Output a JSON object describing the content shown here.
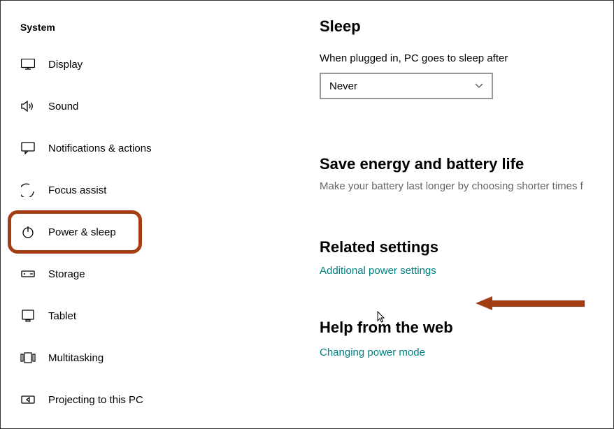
{
  "sidebar": {
    "title": "System",
    "items": [
      {
        "label": "Display"
      },
      {
        "label": "Sound"
      },
      {
        "label": "Notifications & actions"
      },
      {
        "label": "Focus assist"
      },
      {
        "label": "Power & sleep"
      },
      {
        "label": "Storage"
      },
      {
        "label": "Tablet"
      },
      {
        "label": "Multitasking"
      },
      {
        "label": "Projecting to this PC"
      }
    ]
  },
  "main": {
    "sleep_heading": "Sleep",
    "sleep_label": "When plugged in, PC goes to sleep after",
    "sleep_value": "Never",
    "energy_heading": "Save energy and battery life",
    "energy_desc": "Make your battery last longer by choosing shorter times f",
    "related_heading": "Related settings",
    "related_link": "Additional power settings",
    "help_heading": "Help from the web",
    "help_link": "Changing power mode"
  }
}
